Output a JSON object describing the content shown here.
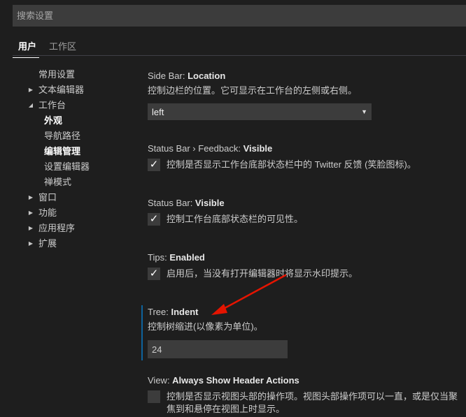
{
  "search": {
    "placeholder": "搜索设置"
  },
  "tabs": [
    {
      "label": "用户",
      "active": true
    },
    {
      "label": "工作区",
      "active": false
    }
  ],
  "toc": [
    {
      "label": "常用设置",
      "twisty": ""
    },
    {
      "label": "文本编辑器",
      "twisty": "▶"
    },
    {
      "label": "工作台",
      "twisty": "◢"
    },
    {
      "label": "外观",
      "twisty": ""
    },
    {
      "label": "导航路径",
      "twisty": ""
    },
    {
      "label": "编辑管理",
      "twisty": ""
    },
    {
      "label": "设置编辑器",
      "twisty": ""
    },
    {
      "label": "禅模式",
      "twisty": ""
    },
    {
      "label": "窗口",
      "twisty": "▶"
    },
    {
      "label": "功能",
      "twisty": "▶"
    },
    {
      "label": "应用程序",
      "twisty": "▶"
    },
    {
      "label": "扩展",
      "twisty": "▶"
    }
  ],
  "settings": {
    "sidebar_location": {
      "category": "Side Bar: ",
      "key": "Location",
      "description": "控制边栏的位置。它可显示在工作台的左侧或右侧。",
      "value": "left"
    },
    "statusbar_feedback": {
      "category": "Status Bar › Feedback: ",
      "key": "Visible",
      "description": "控制是否显示工作台底部状态栏中的 Twitter 反馈 (笑脸图标)。",
      "checked": true
    },
    "statusbar_visible": {
      "category": "Status Bar: ",
      "key": "Visible",
      "description": "控制工作台底部状态栏的可见性。",
      "checked": true
    },
    "tips_enabled": {
      "category": "Tips: ",
      "key": "Enabled",
      "description": "启用后，当没有打开编辑器时将显示水印提示。",
      "checked": true
    },
    "tree_indent": {
      "category": "Tree: ",
      "key": "Indent",
      "description": "控制树缩进(以像素为单位)。",
      "value": "24"
    },
    "header_actions": {
      "category": "View: ",
      "key": "Always Show Header Actions",
      "description": "控制是否显示视图头部的操作项。视图头部操作项可以一直，或是仅当聚焦到和悬停在视图上时显示。",
      "checked": false
    }
  },
  "colors": {
    "focus_bar": "#0e639c",
    "annotation_arrow": "#e51400"
  },
  "icons": {
    "check": "✓",
    "select_chevron": "▼"
  }
}
